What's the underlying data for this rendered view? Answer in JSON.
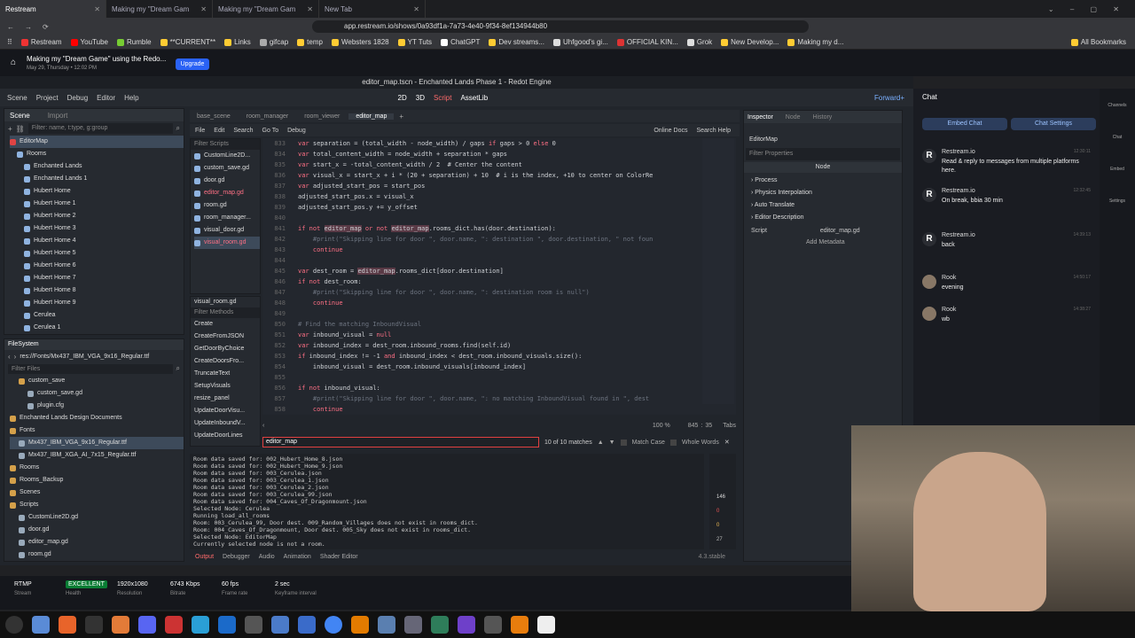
{
  "browser": {
    "tabs": [
      {
        "title": "Restream"
      },
      {
        "title": "Making my \"Dream Gam"
      },
      {
        "title": "Making my \"Dream Gam"
      },
      {
        "title": "New Tab"
      }
    ],
    "url": "app.restream.io/shows/0a93df1a-7a73-4e40-9f34-8ef134944b80",
    "bookmarks": [
      "Restream",
      "YouTube",
      "Rumble",
      "**CURRENT**",
      "Links",
      "gifcap",
      "temp",
      "Websters 1828",
      "YT Tuts",
      "ChatGPT",
      "Dev streams...",
      "Uhfgood's gi...",
      "OFFICIAL KIN...",
      "Grok",
      "New Develop...",
      "Making my d...",
      "All Bookmarks"
    ]
  },
  "restream": {
    "show_title": "Making my \"Dream Game\" using the Redo...",
    "show_date": "May 29, Thursday • 12:02 PM",
    "upgrade": "Upgrade"
  },
  "godot": {
    "window_title": "editor_map.tscn - Enchanted Lands Phase 1 - Redot Engine",
    "menu": [
      "Scene",
      "Project",
      "Debug",
      "Editor",
      "Help"
    ],
    "workspaces": [
      "2D",
      "3D",
      "Script",
      "AssetLib"
    ],
    "renderer": "Forward+",
    "scene_tabs": [
      "Scene",
      "Import"
    ],
    "filter_nodes": "Filter: name, t:type, g:group",
    "scene_tree": [
      "EditorMap",
      "Rooms",
      "Enchanted Lands",
      "Enchanted Lands 1",
      "Hubert Home",
      "Hubert Home 1",
      "Hubert Home 2",
      "Hubert Home 3",
      "Hubert Home 4",
      "Hubert Home 5",
      "Hubert Home 6",
      "Hubert Home 7",
      "Hubert Home 8",
      "Hubert Home 9",
      "Cerulea",
      "Cerulea 1"
    ],
    "open_tabs": [
      "base_scene",
      "room_manager",
      "room_viewer",
      "editor_map"
    ],
    "script_menu": [
      "File",
      "Edit",
      "Search",
      "Go To",
      "Debug"
    ],
    "online_docs": "Online Docs",
    "search_help": "Search Help",
    "filter_scripts": "Filter Scripts",
    "scripts": [
      "CustomLine2D...",
      "custom_save.gd",
      "door.gd",
      "editor_map.gd",
      "room.gd",
      "room_manager...",
      "visual_door.gd",
      "visual_room.gd"
    ],
    "current_script": "visual_room.gd",
    "filter_methods": "Filter Methods",
    "methods": [
      "Create",
      "CreateFromJSON",
      "GetDoorByChoice",
      "CreateDoorsFro...",
      "TruncateText",
      "SetupVisuals",
      "resize_panel",
      "UpdateDoorVisu...",
      "UpdateInboundV...",
      "UpdateDoorLines"
    ],
    "code": [
      {
        "n": "833",
        "t": "var separation = (total_width - node_width) / gaps if gaps > 0 else 0"
      },
      {
        "n": "834",
        "t": "var total_content_width = node_width + separation * gaps"
      },
      {
        "n": "835",
        "t": "var start_x = -total_content_width / 2  # Center the content"
      },
      {
        "n": "836",
        "t": "var visual_x = start_x + i * (20 + separation) + 10  # i is the index, +10 to center on ColorRe"
      },
      {
        "n": "837",
        "t": "var adjusted_start_pos = start_pos"
      },
      {
        "n": "838",
        "t": "adjusted_start_pos.x = visual_x"
      },
      {
        "n": "839",
        "t": "adjusted_start_pos.y += y_offset"
      },
      {
        "n": "840",
        "t": ""
      },
      {
        "n": "841",
        "t": "if not editor_map or not editor_map.rooms_dict.has(door.destination):"
      },
      {
        "n": "842",
        "t": "    #print(\"Skipping line for door \", door.name, \": destination \", door.destination, \" not foun"
      },
      {
        "n": "843",
        "t": "    continue"
      },
      {
        "n": "844",
        "t": ""
      },
      {
        "n": "845",
        "t": "var dest_room = editor_map.rooms_dict[door.destination]"
      },
      {
        "n": "846",
        "t": "if not dest_room:"
      },
      {
        "n": "847",
        "t": "    #print(\"Skipping line for door \", door.name, \": destination room is null\")"
      },
      {
        "n": "848",
        "t": "    continue"
      },
      {
        "n": "849",
        "t": ""
      },
      {
        "n": "850",
        "t": "# Find the matching InboundVisual"
      },
      {
        "n": "851",
        "t": "var inbound_visual = null"
      },
      {
        "n": "852",
        "t": "var inbound_index = dest_room.inbound_rooms.find(self.id)"
      },
      {
        "n": "853",
        "t": "if inbound_index != -1 and inbound_index < dest_room.inbound_visuals.size():"
      },
      {
        "n": "854",
        "t": "    inbound_visual = dest_room.inbound_visuals[inbound_index]"
      },
      {
        "n": "855",
        "t": ""
      },
      {
        "n": "856",
        "t": "if not inbound_visual:"
      },
      {
        "n": "857",
        "t": "    #print(\"Skipping line for door \", door.name, \": no matching InboundVisual found in \", dest"
      },
      {
        "n": "858",
        "t": "    continue"
      }
    ],
    "zoom": "100 %",
    "cursor_line": "845",
    "cursor_col": "35",
    "indent": "Tabs",
    "search_value": "editor_map",
    "match_count": "10 of 10 matches",
    "match_case": "Match Case",
    "whole_words": "Whole Words",
    "filesystem_label": "FileSystem",
    "fs_path": "res://Fonts/Mx437_IBM_VGA_9x16_Regular.ttf",
    "filter_files": "Filter Files",
    "filesystem": [
      "custom_save",
      "custom_save.gd",
      "plugin.cfg",
      "Enchanted Lands Design Documents",
      "Fonts",
      "Mx437_IBM_VGA_9x16_Regular.ttf",
      "Mx437_IBM_XGA_AI_7x15_Regular.ttf",
      "Rooms",
      "Rooms_Backup",
      "Scenes",
      "Scripts",
      "CustomLine2D.gd",
      "door.gd",
      "editor_map.gd",
      "room.gd"
    ],
    "output": [
      "Room data saved for: 002_Hubert_Home_8.json",
      "Room data saved for: 002_Hubert_Home_9.json",
      "Room data saved for: 003_Cerulea.json",
      "Room data saved for: 003_Cerulea_1.json",
      "Room data saved for: 003_Cerulea_2.json",
      "Room data saved for: 003_Cerulea_99.json",
      "Room data saved for: 004_Caves_Of_Dragonmount.json",
      "Selected Node: Cerulea",
      "Running load_all_rooms",
      "Room: 003_Cerulea_99, Door dest. 009_Random_Villages does not exist in rooms_dict.",
      "Room: 004_Caves_Of_Dragonmount, Door dest. 005_Sky does not exist in rooms_dict.",
      "Selected Node: EditorMap",
      "Currently selected node is not a room."
    ],
    "bottom_tabs": [
      "Output",
      "Debugger",
      "Audio",
      "Animation",
      "Shader Editor"
    ],
    "version": "4.3.stable",
    "log_counts": [
      "146",
      "0",
      "0",
      "27"
    ],
    "inspector_tabs": [
      "Inspector",
      "Node",
      "History"
    ],
    "inspector_node": "EditorMap",
    "filter_properties": "Filter Properties",
    "section_node": "Node",
    "sections": [
      "Process",
      "Physics Interpolation",
      "Auto Translate",
      "Editor Description"
    ],
    "script_label": "Script",
    "script_value": "editor_map.gd",
    "add_metadata": "Add Metadata"
  },
  "chat": {
    "title": "Chat",
    "embed_button": "Embed Chat",
    "settings_button": "Chat Settings",
    "messages": [
      {
        "author": "Restream.io",
        "time": "12:30:11",
        "text": "Read & reply to messages from multiple platforms here."
      },
      {
        "author": "Restream.io",
        "time": "12:32:45",
        "text": "On break, bbia 30 min"
      },
      {
        "author": "Restream.io",
        "time": "14:39:13",
        "text": "back"
      },
      {
        "author": "Rook",
        "time": "14:50:17",
        "text": "evening"
      },
      {
        "author": "Rook",
        "time": "14:38:27",
        "text": "wb"
      }
    ],
    "rail": [
      "Channels",
      "Chat",
      "Embed",
      "Settings"
    ]
  },
  "stats": {
    "protocol": "RTMP",
    "protocol_sub": "Stream",
    "health": "EXCELLENT",
    "health_sub": "Health",
    "resolution": "1920x1080",
    "resolution_sub": "Resolution",
    "bitrate": "6743 Kbps",
    "bitrate_sub": "Bitrate",
    "fps": "60 fps",
    "fps_sub": "Frame rate",
    "keyframe": "2 sec",
    "keyframe_sub": "Keyframe interval"
  }
}
